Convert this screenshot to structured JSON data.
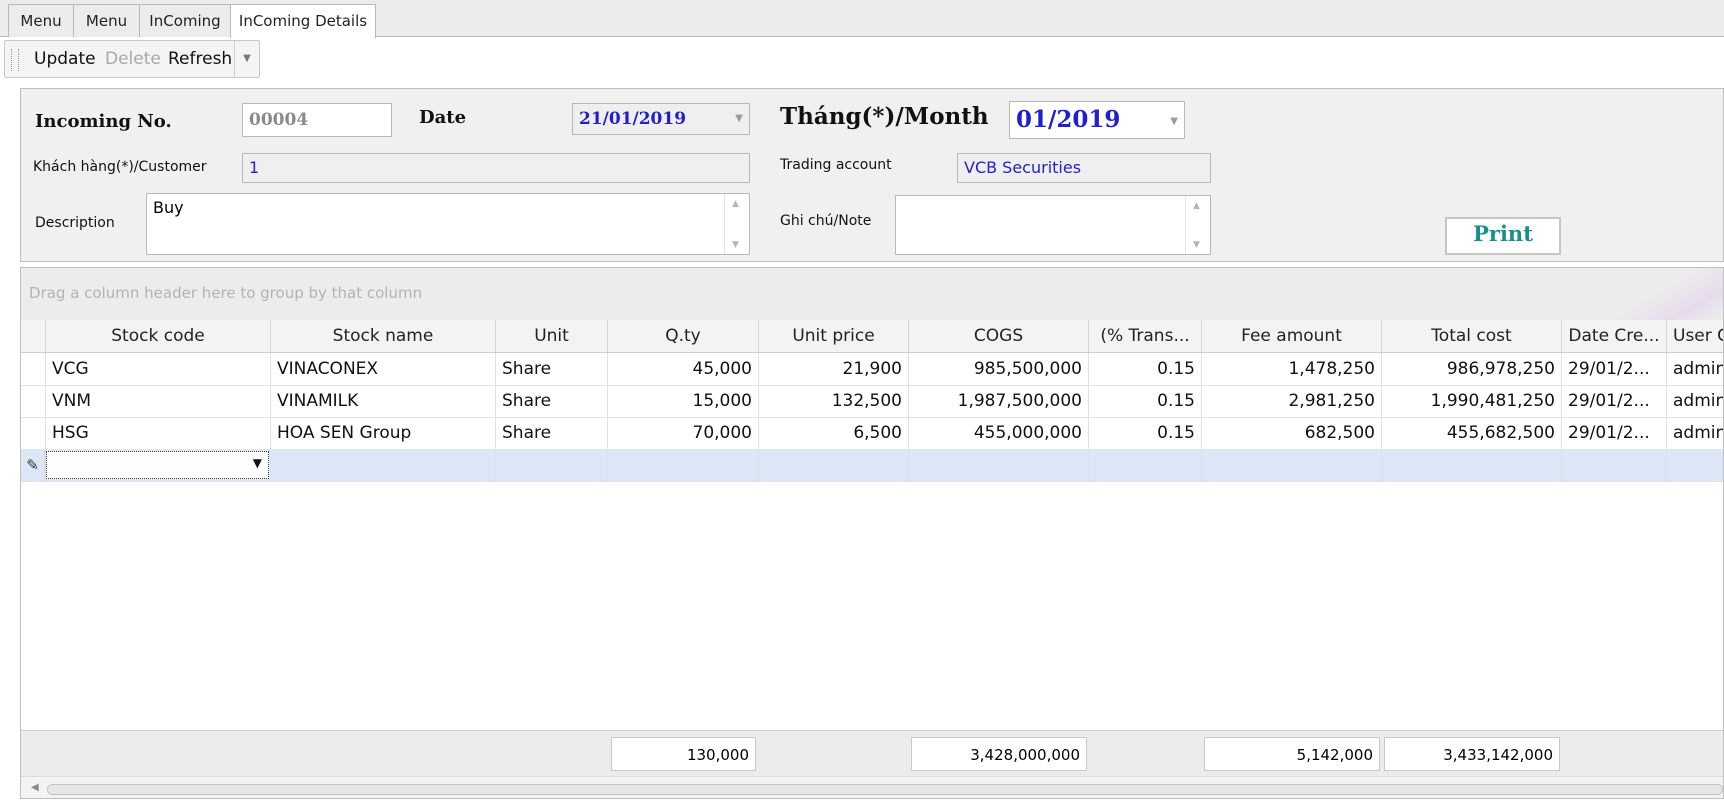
{
  "tabs": [
    {
      "label": "Menu"
    },
    {
      "label": "Menu"
    },
    {
      "label": "InComing"
    },
    {
      "label": "InComing Details",
      "active": true
    }
  ],
  "toolbar": {
    "update_label": "Update",
    "delete_label": "Delete",
    "refresh_label": "Refresh"
  },
  "form": {
    "incoming_no_label": "Incoming No.",
    "incoming_no_value": "00004",
    "date_label": "Date",
    "date_value": "21/01/2019",
    "month_label": "Tháng(*)/Month",
    "month_value": "01/2019",
    "customer_label": "Khách hàng(*)/Customer",
    "customer_value": "1",
    "trading_account_label": "Trading account",
    "trading_account_value": "VCB Securities",
    "description_label": "Description",
    "description_value": "Buy",
    "note_label": "Ghi chú/Note",
    "note_value": "",
    "print_label": "Print"
  },
  "grid": {
    "group_hint": "Drag a column header here to group by that column",
    "columns": [
      "Stock code",
      "Stock name",
      "Unit",
      "Q.ty",
      "Unit price",
      "COGS",
      "(% Trans...",
      "Fee amount",
      "Total cost",
      "Date Cre...",
      "User C"
    ],
    "rows": [
      [
        "VCG",
        "VINACONEX",
        "Share",
        "45,000",
        "21,900",
        "985,500,000",
        "0.15",
        "1,478,250",
        "986,978,250",
        "29/01/2...",
        "admin"
      ],
      [
        "VNM",
        "VINAMILK",
        "Share",
        "15,000",
        "132,500",
        "1,987,500,000",
        "0.15",
        "2,981,250",
        "1,990,481,250",
        "29/01/2...",
        "admin"
      ],
      [
        "HSG",
        "HOA SEN Group",
        "Share",
        "70,000",
        "6,500",
        "455,000,000",
        "0.15",
        "682,500",
        "455,682,500",
        "29/01/2...",
        "admin"
      ]
    ],
    "totals": {
      "qty": "130,000",
      "cogs": "3,428,000,000",
      "fee": "5,142,000",
      "total_cost": "3,433,142,000"
    }
  },
  "colors": {
    "link_blue": "#1f1fd0",
    "print_teal": "#1a8f8a",
    "new_row_bg": "#dce6f7"
  }
}
